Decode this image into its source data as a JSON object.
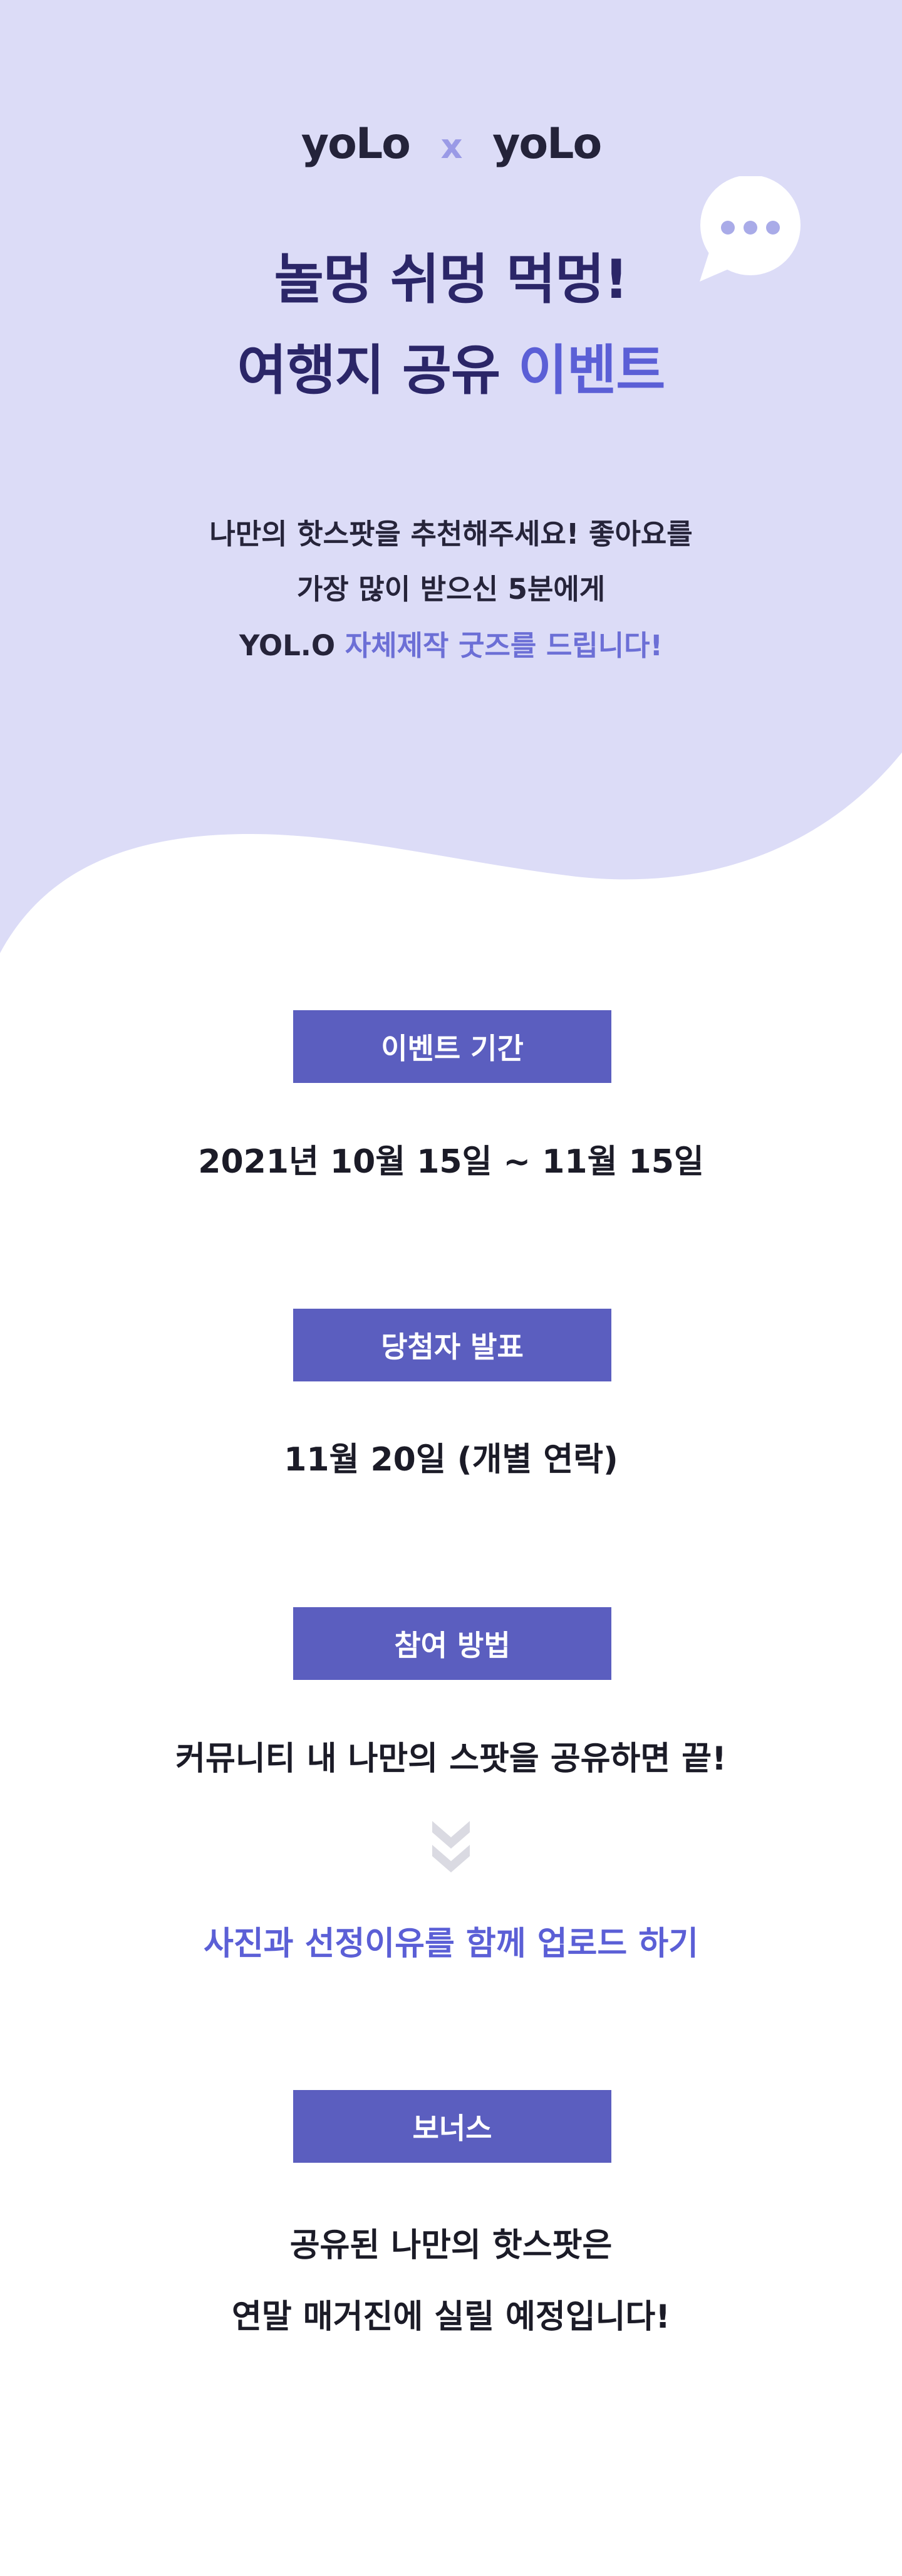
{
  "header": {
    "logo_left": "yoLo",
    "logo_separator": "x",
    "logo_right": "yoLo",
    "bubble_icon": "chat-bubble-ellipsis"
  },
  "title": {
    "line1": "놀멍 쉬멍 먹멍!",
    "line2_main": "여행지 공유 ",
    "line2_accent": "이벤트"
  },
  "intro": {
    "line1": "나만의 핫스팟을 추천해주세요! 좋아요를",
    "line2": "가장 많이 받으신 5분에게",
    "line3_main": "YOL.O ",
    "line3_accent": "자체제작 굿즈를 드립니다!"
  },
  "sections": {
    "period": {
      "label": "이벤트 기간",
      "text": "2021년 10월 15일 ~ 11월 15일"
    },
    "winner": {
      "label": "당첨자 발표",
      "text": "11월 20일 (개별 연락)"
    },
    "method": {
      "label": "참여 방법",
      "text": "커뮤니티 내 나만의 스팟을 공유하면 끝!",
      "step2": "사진과 선정이유를 함께 업로드 하기"
    },
    "bonus": {
      "label": "보너스",
      "text_line1": "공유된 나만의 핫스팟은",
      "text_line2": "연말 매거진에 실릴 예정입니다!"
    }
  },
  "colors": {
    "hero_bg": "#dcdcf7",
    "accent": "#5b5fd6",
    "badge": "#5b5ebf",
    "title_dark": "#2b2668",
    "chevron": "#d9d9e0"
  }
}
